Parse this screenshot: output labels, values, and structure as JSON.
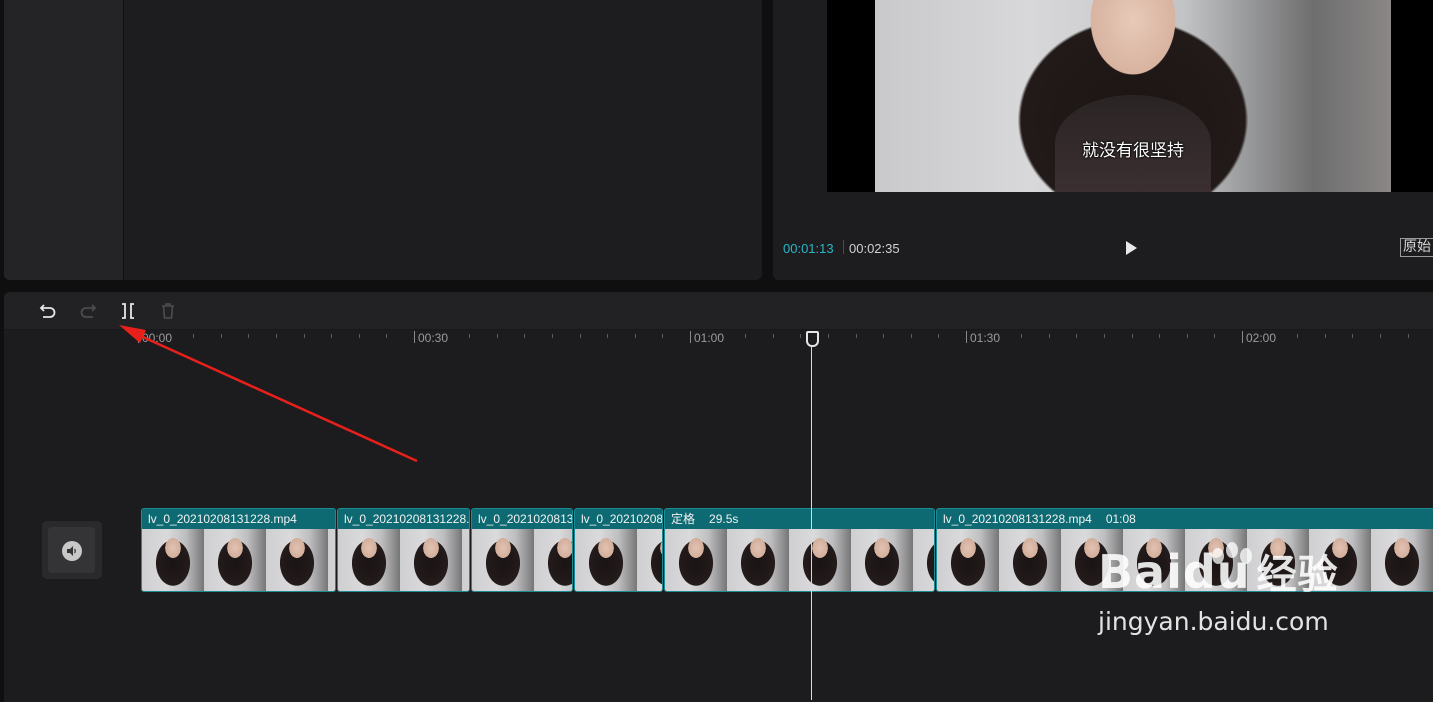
{
  "player": {
    "subtitle": "就没有很坚持",
    "current_time": "00:01:13",
    "total_time": "00:02:35",
    "ratio_label": "原始"
  },
  "toolbar": {
    "undo": "undo-icon",
    "redo": "redo-icon",
    "split": "split-icon",
    "delete": "trash-icon"
  },
  "ruler": {
    "labels": [
      "00:00",
      "00:30",
      "01:00",
      "01:30",
      "02:00"
    ]
  },
  "track": {
    "clips": [
      {
        "name": "lv_0_20210208131228.mp4",
        "duration": ""
      },
      {
        "name": "lv_0_20210208131228.",
        "duration": ""
      },
      {
        "name": "lv_0_2021020813",
        "duration": ""
      },
      {
        "name": "lv_0_20210208",
        "duration": ""
      },
      {
        "name": "定格",
        "duration": "29.5s"
      },
      {
        "name": "lv_0_20210208131228.mp4",
        "duration": "01:08"
      }
    ]
  },
  "watermark": {
    "brand": "Bai",
    "brand_suffix": "du",
    "brand_cn": "经验",
    "url": "jingyan.baidu.com"
  },
  "colors": {
    "accent": "#27b6c8",
    "clip": "#0e6a72",
    "arrow": "#e8201c"
  }
}
